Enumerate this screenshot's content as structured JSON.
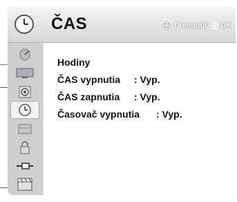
{
  "header": {
    "title": "ČAS",
    "hint_move": "Presunúť",
    "hint_ok": "OK"
  },
  "sidebar": {
    "items": [
      {
        "icon": "satellite-dish-icon",
        "active": false
      },
      {
        "icon": "tv-screen-icon",
        "active": false
      },
      {
        "icon": "speaker-icon",
        "active": false
      },
      {
        "icon": "clock-icon",
        "active": true
      },
      {
        "icon": "lock-box-icon",
        "active": false
      },
      {
        "icon": "padlock-icon",
        "active": false
      },
      {
        "icon": "plug-cable-icon",
        "active": false
      },
      {
        "icon": "clapperboard-icon",
        "active": false
      }
    ]
  },
  "menu": {
    "items": [
      {
        "label": "Hodiny",
        "value": ""
      },
      {
        "label": "ČAS vypnutia",
        "value": ": Vyp."
      },
      {
        "label": "ČAS zapnutia",
        "value": ": Vyp."
      },
      {
        "label": "Časovač vypnutia",
        "value": ": Vyp."
      }
    ]
  },
  "colors": {
    "panel": "#d9d9d9",
    "content": "#ffffff",
    "text": "#111111"
  }
}
